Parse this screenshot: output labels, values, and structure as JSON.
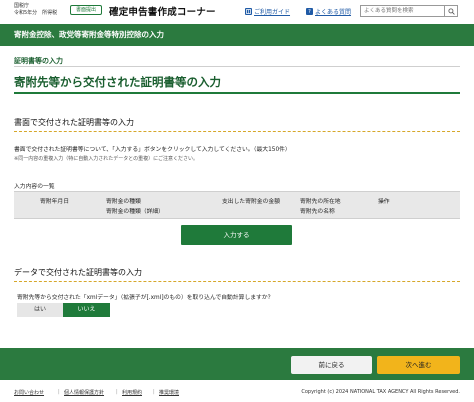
{
  "header": {
    "agency_line1": "国税庁",
    "agency_line2": "令和5年分　所得税",
    "badge": "書面提出",
    "title": "確定申告書作成コーナー",
    "guide_link": "ご利用ガイド",
    "faq_link": "よくある質問",
    "search_placeholder": "よくある質問を検索"
  },
  "bar_title": "寄附金控除、政党等寄附金等特別控除の入力",
  "section_label": "証明書等の入力",
  "page_title": "寄附先等から交付された証明書等の入力",
  "paper": {
    "heading": "書面で交付された証明書等の入力",
    "description": "書面で交付された証明書等について、「入力する」ボタンをクリックして入力してください。（最大150件）",
    "note": "※同一内容の重複入力（特に自動入力されたデータとの重複）にご注意ください。",
    "table_caption": "入力内容の一覧",
    "columns": [
      {
        "line1": "寄附年月日",
        "line2": ""
      },
      {
        "line1": "寄附金の種類",
        "line2": "寄附金の種類（詳細）"
      },
      {
        "line1": "支出した寄附金の金額",
        "line2": ""
      },
      {
        "line1": "寄附先の所在地",
        "line2": "寄附先の名称"
      },
      {
        "line1": "操作",
        "line2": ""
      }
    ],
    "input_button": "入力する"
  },
  "data": {
    "heading": "データで交付された証明書等の入力",
    "question": "寄附先等から交付された「xmlデータ」（拡張子が[.xml]のもの）を取り込んで自動計算しますか？",
    "yes": "はい",
    "no": "いいえ"
  },
  "footer": {
    "back": "前に戻る",
    "next": "次へ進む",
    "links": [
      "お問い合わせ",
      "個人情報保護方針",
      "利用規約",
      "推奨環境"
    ],
    "copyright": "Copyright (c) 2024 NATIONAL TAX AGENCY All Rights Reserved."
  },
  "colors": {
    "primary_green": "#2b7a3f",
    "accent_yellow": "#f2b41b",
    "link_blue": "#1f5aa6"
  }
}
